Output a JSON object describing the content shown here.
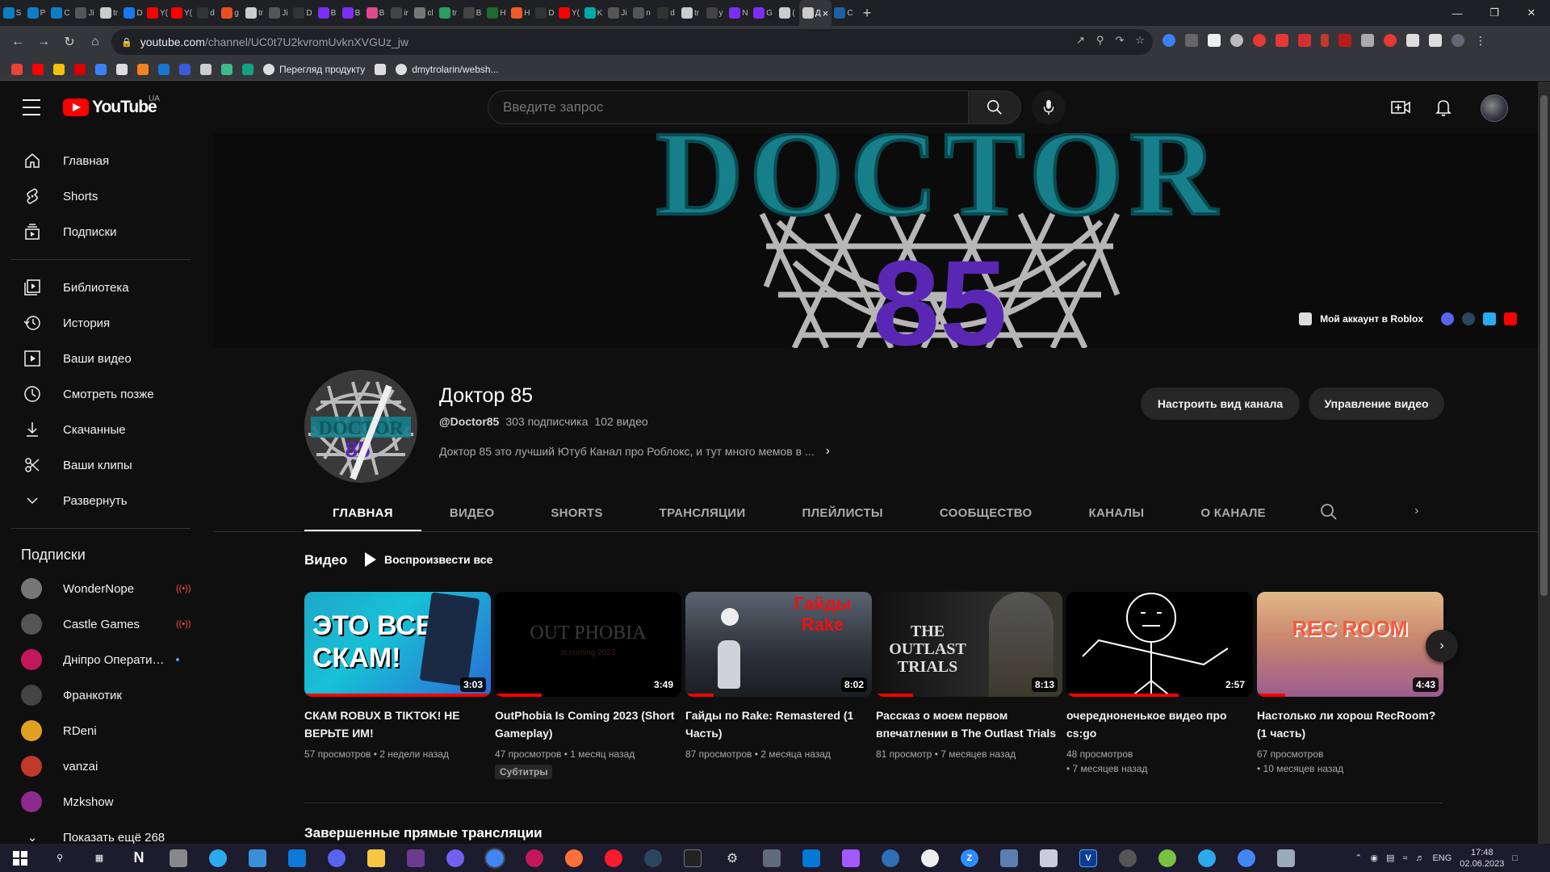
{
  "browser": {
    "tabs": [
      {
        "label": "S",
        "color": "#0e7ec4"
      },
      {
        "label": "P",
        "color": "#0e7ec4"
      },
      {
        "label": "C",
        "color": "#0e7ec4"
      },
      {
        "label": "Ji",
        "color": "#555"
      },
      {
        "label": "tr",
        "color": "#ccc"
      },
      {
        "label": "D",
        "color": "#1877f2"
      },
      {
        "label": "Y(",
        "color": "#ff0000"
      },
      {
        "label": "Y(",
        "color": "#ff0000"
      },
      {
        "label": "d",
        "color": "#333"
      },
      {
        "label": "g",
        "color": "#e8501c"
      },
      {
        "label": "tr",
        "color": "#ccc"
      },
      {
        "label": "Ji",
        "color": "#555"
      },
      {
        "label": "D",
        "color": "#333"
      },
      {
        "label": "B",
        "color": "#7a2ff5"
      },
      {
        "label": "B",
        "color": "#7a2ff5"
      },
      {
        "label": "B",
        "color": "#e04b8a"
      },
      {
        "label": "ir",
        "color": "#444"
      },
      {
        "label": "cl",
        "color": "#777"
      },
      {
        "label": "tr",
        "color": "#2a9d5c"
      },
      {
        "label": "B",
        "color": "#444"
      },
      {
        "label": "H",
        "color": "#1c6b2f"
      },
      {
        "label": "H",
        "color": "#f05a28"
      },
      {
        "label": "D",
        "color": "#333"
      },
      {
        "label": "Y(",
        "color": "#ff0000"
      },
      {
        "label": "K",
        "color": "#0aa"
      },
      {
        "label": "Ji",
        "color": "#555"
      },
      {
        "label": "n",
        "color": "#555"
      },
      {
        "label": "d",
        "color": "#333"
      },
      {
        "label": "tr",
        "color": "#ccc"
      },
      {
        "label": "y",
        "color": "#444"
      },
      {
        "label": "N",
        "color": "#7a2ff5"
      },
      {
        "label": "G",
        "color": "#7a2ff5"
      },
      {
        "label": "(",
        "color": "#ccc"
      },
      {
        "label": "Д",
        "color": "#ccc",
        "active": true
      },
      {
        "label": "C",
        "color": "#1b5fa8"
      }
    ],
    "new_tab": "+",
    "url_main": "youtube.com",
    "url_path": "/channel/UC0t7U2kvromUvknXVGUz_jw",
    "bookmarks": [
      {
        "label": "",
        "color": "#ea4335"
      },
      {
        "label": "",
        "color": "#ff0000"
      },
      {
        "label": "",
        "color": "#f4c20d"
      },
      {
        "label": "",
        "color": "#d00"
      },
      {
        "label": "",
        "color": "#3b82f6"
      },
      {
        "label": "",
        "color": "#ddd"
      },
      {
        "label": "",
        "color": "#f58220"
      },
      {
        "label": "",
        "color": "#1976d2"
      },
      {
        "label": "",
        "color": "#3b5bdb"
      },
      {
        "label": "",
        "color": "#ccc"
      },
      {
        "label": "",
        "color": "#3dbb8e"
      },
      {
        "label": "",
        "color": "#10a37f"
      },
      {
        "label": "Перегляд продукту",
        "color": "#ddd"
      },
      {
        "label": "",
        "color": "#ddd"
      },
      {
        "label": "dmytrolarin/websh...",
        "color": "#ddd"
      }
    ]
  },
  "youtube": {
    "logo_text": "YouTube",
    "region": "UA",
    "search_placeholder": "Введите запрос",
    "sidebar": {
      "main": [
        {
          "label": "Главная",
          "icon": "home-icon"
        },
        {
          "label": "Shorts",
          "icon": "shorts-icon"
        },
        {
          "label": "Подписки",
          "icon": "subscriptions-icon"
        }
      ],
      "library": [
        {
          "label": "Библиотека",
          "icon": "library-icon"
        },
        {
          "label": "История",
          "icon": "history-icon"
        },
        {
          "label": "Ваши видео",
          "icon": "your-videos-icon"
        },
        {
          "label": "Смотреть позже",
          "icon": "watch-later-icon"
        },
        {
          "label": "Скачанные",
          "icon": "download-icon"
        },
        {
          "label": "Ваши клипы",
          "icon": "clips-icon"
        },
        {
          "label": "Развернуть",
          "icon": "chevron-down-icon"
        }
      ],
      "subscriptions_heading": "Подписки",
      "subscriptions": [
        {
          "name": "WonderNope",
          "badge": "live",
          "color": "#777"
        },
        {
          "name": "Castle Games",
          "badge": "live",
          "color": "#555"
        },
        {
          "name": "Дніпро Оперативний",
          "badge": "new",
          "color": "#c2185b"
        },
        {
          "name": "Франкотик",
          "badge": "",
          "color": "#444"
        },
        {
          "name": "RDeni",
          "badge": "",
          "color": "#e0a020"
        },
        {
          "name": "vanzai",
          "badge": "",
          "color": "#c0392b"
        },
        {
          "name": "Mzkshow",
          "badge": "",
          "color": "#8e2a8e"
        }
      ],
      "show_more": "Показать ещё 268"
    },
    "banner": {
      "title_line1": "DOCTOR",
      "title_line2": "85",
      "link_label": "Мой аккаунт в Roblox"
    },
    "channel": {
      "name": "Доктор 85",
      "handle": "@Doctor85",
      "subscribers": "303 подписчика",
      "videos": "102 видео",
      "description": "Доктор 85 это лучший Ютуб Канал про Роблокс, и тут много мемов в ...",
      "customize_button": "Настроить вид канала",
      "manage_button": "Управление видео"
    },
    "tabs": [
      {
        "label": "ГЛАВНАЯ",
        "active": true
      },
      {
        "label": "ВИДЕО"
      },
      {
        "label": "SHORTS"
      },
      {
        "label": "ТРАНСЛЯЦИИ"
      },
      {
        "label": "ПЛЕЙЛИСТЫ"
      },
      {
        "label": "СООБЩЕСТВО"
      },
      {
        "label": "КАНАЛЫ"
      },
      {
        "label": "О КАНАЛЕ"
      }
    ],
    "shelf": {
      "title": "Видео",
      "play_all": "Воспроизвести все",
      "videos": [
        {
          "title": "СКАМ ROBUX В TIKTOK! НЕ ВЕРЬТЕ ИМ!",
          "duration": "3:03",
          "meta1": "57 просмотров • 2 недели назад",
          "meta2": "",
          "thumb_text": "ЭТО ВСЕ СКАМ!",
          "progress": 1.0,
          "cc": ""
        },
        {
          "title": "OutPhobia Is Coming 2023 (Short Gameplay)",
          "duration": "3:49",
          "meta1": "47 просмотров • 1 месяц назад",
          "meta2": "",
          "thumb_text": "OUT PHOBIA",
          "thumb_sub": "Is coming 2023",
          "progress": 0.25,
          "cc": "Субтитры"
        },
        {
          "title": "Гайды по Rake: Remastered (1 Часть)",
          "duration": "8:02",
          "meta1": "87 просмотров • 2 месяца назад",
          "meta2": "",
          "thumb_text": "Гайды Rake",
          "progress": 0.15,
          "cc": ""
        },
        {
          "title": "Рассказ о моем первом впечатлении в The Outlast Trials",
          "duration": "8:13",
          "meta1": "81 просмотр • 7 месяцев назад",
          "meta2": "",
          "thumb_text": "THE OUTLAST TRIALS",
          "progress": 0.2,
          "cc": ""
        },
        {
          "title": "очередноненькое видео про cs:go",
          "duration": "2:57",
          "meta1": "48 просмотров",
          "meta2": "• 7 месяцев назад",
          "thumb_text": "",
          "progress": 0.6,
          "cc": ""
        },
        {
          "title": "Настолько ли хорош RecRoom? (1 часть)",
          "duration": "4:43",
          "meta1": "67 просмотров",
          "meta2": "• 10 месяцев назад",
          "thumb_text": "REC ROOM",
          "progress": 0.15,
          "cc": ""
        }
      ]
    },
    "next_section": "Завершенные прямые трансляции"
  },
  "taskbar": {
    "lang": "ENG",
    "time": "17:48",
    "date": "02.06.2023"
  }
}
